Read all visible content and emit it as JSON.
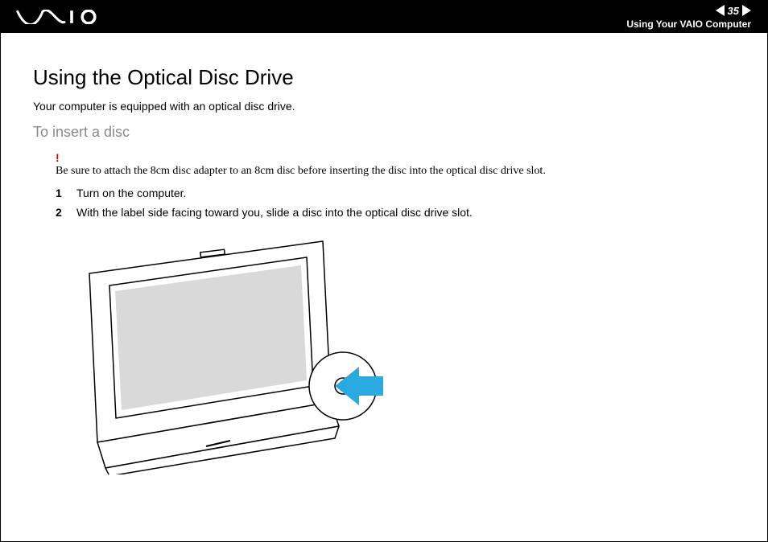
{
  "header": {
    "page_number": "35",
    "section": "Using Your VAIO Computer",
    "logo_name": "vaio-logo"
  },
  "content": {
    "title": "Using the Optical Disc Drive",
    "intro": "Your computer is equipped with an optical disc drive.",
    "subtitle": "To insert a disc",
    "warning_mark": "!",
    "warning_text": "Be sure to attach the 8cm disc adapter to an 8cm disc before inserting the disc into the optical disc drive slot.",
    "steps": [
      {
        "n": "1",
        "text": "Turn on the computer."
      },
      {
        "n": "2",
        "text": "With the label side facing toward you, slide a disc into the optical disc drive slot."
      }
    ],
    "illustration_alt": "VAIO all-in-one computer with disc being inserted into side slot"
  },
  "icons": {
    "prev": "prev-page-icon",
    "next": "next-page-icon"
  },
  "colors": {
    "accent_arrow": "#29abe2",
    "muted_heading": "#8a8a8a",
    "warning": "#d00000"
  }
}
